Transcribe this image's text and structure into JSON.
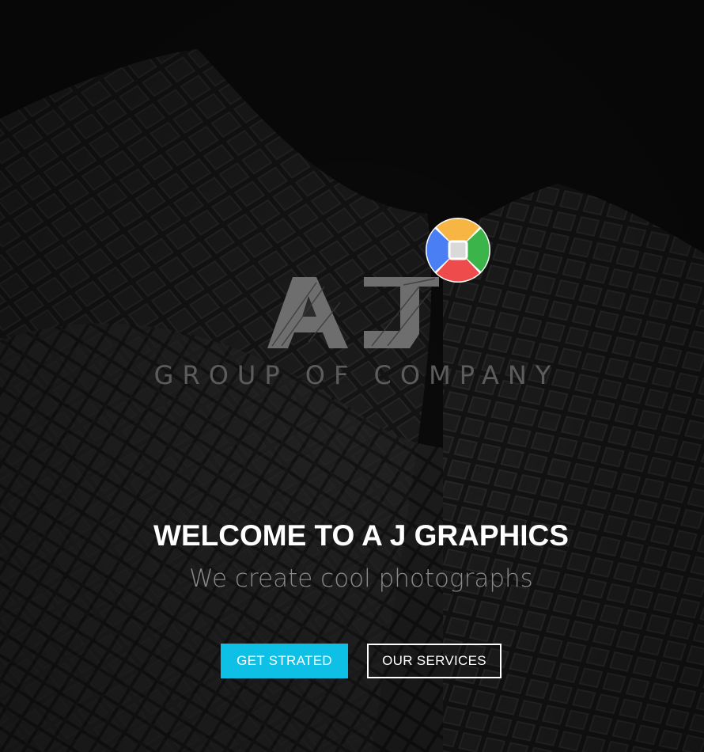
{
  "logo": {
    "letters": "AJ",
    "tagline": "GROUP OF COMPANY",
    "badge_colors": [
      "#f7b544",
      "#3bb44a",
      "#ee4c4c",
      "#4a7ef5"
    ]
  },
  "hero": {
    "title": "WELCOME TO A J GRAPHICS",
    "subtitle": "We create cool photographs",
    "background_icon": "building-photo"
  },
  "buttons": {
    "get_started": "GET STRATED",
    "services": "OUR SERVICES"
  },
  "colors": {
    "accent": "#0ec0e6",
    "background": "#0a0a0a"
  }
}
